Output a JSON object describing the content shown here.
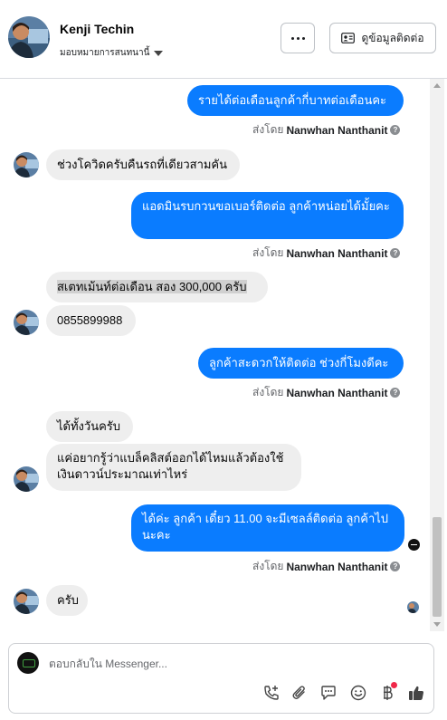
{
  "header": {
    "contact_name": "Kenji Techin",
    "assign_label": "มอบหมายการสนทนานี้",
    "more_button_icon": "more-horizontal-icon",
    "contact_info_button": "ดูข้อมูลติดต่อ",
    "contact_info_icon": "id-card-icon"
  },
  "thread": {
    "messages": [
      {
        "direction": "outgoing",
        "text": "รายได้ต่อเดือนลูกค้ากี่บาทต่อเดือนคะ"
      },
      {
        "direction": "incoming",
        "text": "ช่วงโควิดครับคืนรถที่เดียวสามคัน"
      },
      {
        "direction": "outgoing",
        "text": "แอดมินรบกวนขอเบอร์ติดต่อ ลูกค้าหน่อยได้มั้ยคะ"
      },
      {
        "direction": "incoming",
        "text": "สเตทเม้นท์ต่อเดือน สอง 300,000 ครับ"
      },
      {
        "direction": "incoming",
        "text": "0855899988"
      },
      {
        "direction": "outgoing",
        "text": "ลูกค้าสะดวกให้ติดต่อ ช่วงกี่โมงดีคะ"
      },
      {
        "direction": "incoming",
        "text": "ได้ทั้งวันครับ"
      },
      {
        "direction": "incoming",
        "text": "แค่อยากรู้ว่าแบล็คลิสต์ออกได้ไหมแล้วต้องใช้เงินดาวน์ประมาณเท่าไหร่"
      },
      {
        "direction": "outgoing",
        "text": "ได้ค่ะ ลูกค้า เดี๋ยว 11.00 จะมีเซลล์ติดต่อ ลูกค้าไปนะคะ"
      },
      {
        "direction": "incoming",
        "text": "ครับ"
      }
    ],
    "sent_by_prefix": "ส่งโดย",
    "sent_by_name": "Nanwhan Nanthanit",
    "help_icon_glyph": "?"
  },
  "composer": {
    "placeholder": "ตอบกลับใน Messenger...",
    "tools": [
      "call-add-icon",
      "attachment-icon",
      "saved-reply-icon",
      "emoji-icon",
      "baht-payment-icon",
      "like-icon"
    ]
  },
  "colors": {
    "outgoing_bubble": "#0a7cff",
    "incoming_bubble": "#eeeeee",
    "notification_dot": "#f02849"
  }
}
